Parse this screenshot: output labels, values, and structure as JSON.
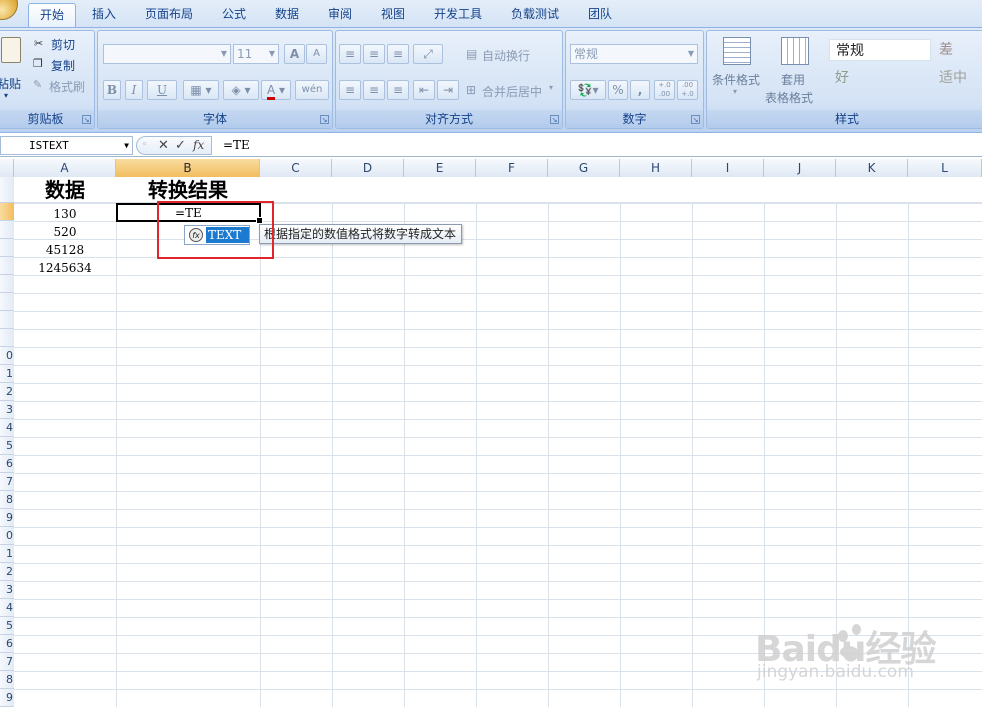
{
  "tabs": [
    "开始",
    "插入",
    "页面布局",
    "公式",
    "数据",
    "审阅",
    "视图",
    "开发工具",
    "负载测试",
    "团队"
  ],
  "active_tab": "开始",
  "ribbon": {
    "clipboard": {
      "paste_label": "粘贴",
      "cut": "剪切",
      "copy": "复制",
      "format_painter": "格式刷",
      "group_label": "剪贴板"
    },
    "font": {
      "font_name": "",
      "font_size": "11",
      "group_label": "字体",
      "grow": "A",
      "shrink": "A",
      "bold": "B",
      "italic": "I",
      "underline": "U",
      "phonetic": "wén"
    },
    "alignment": {
      "wrap_text": "自动换行",
      "merge_center": "合并后居中",
      "group_label": "对齐方式"
    },
    "number": {
      "format": "常规",
      "percent": "%",
      "comma": ",",
      "inc_decimal": "+.0 .00",
      "dec_decimal": ".00 +.0",
      "group_label": "数字"
    },
    "styles": {
      "conditional_format": "条件格式",
      "table_format_1": "套用",
      "table_format_2": "表格格式",
      "normal": "常规",
      "bad": "差",
      "good": "好",
      "neutral": "适中",
      "group_label": "样式"
    }
  },
  "formula_bar": {
    "name_box": "ISTEXT",
    "formula": "=TE",
    "fx": "fx"
  },
  "columns": [
    "A",
    "B",
    "C",
    "D",
    "E",
    "F",
    "G",
    "H",
    "I",
    "J",
    "K",
    "L"
  ],
  "row_labels": [
    "",
    "",
    "",
    "",
    "",
    "",
    "",
    "",
    "",
    "0",
    "1",
    "2",
    "3",
    "4",
    "5",
    "6",
    "7",
    "8",
    "9",
    "0",
    "1",
    "2",
    "3",
    "4",
    "5",
    "6",
    "7",
    "8",
    "9"
  ],
  "cells": {
    "a1": "数据",
    "b1": "转换结果",
    "a2": "130",
    "a3": "520",
    "a4": "45128",
    "a5": "1245634",
    "b2": "=TE"
  },
  "autocomplete": {
    "item": "TEXT",
    "tooltip": "根据指定的数值格式将数字转成文本"
  },
  "watermark": {
    "logo": "Baidu经验",
    "url": "jingyan.baidu.com"
  },
  "colors": {
    "accent": "#15428b",
    "highlight": "#f2bd5e",
    "selection_blue": "#1c7bd0",
    "annotation_red": "#e0262b"
  }
}
